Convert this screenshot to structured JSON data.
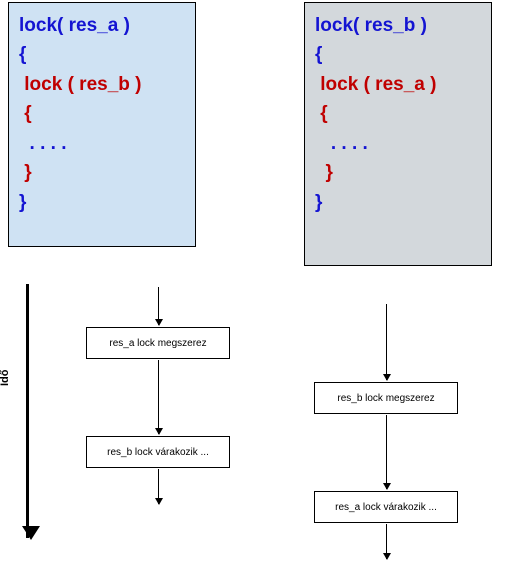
{
  "colors": {
    "block_left_bg": "#cfe2f3",
    "block_right_bg": "#d3d8dc",
    "outer_code": "#1414d2",
    "inner_code": "#c00000"
  },
  "left_code": {
    "l1": "lock( res_a )",
    "l2": "{",
    "l3": " lock ( res_b )",
    "l4": " {",
    "l5": "  . . . .",
    "l6": " }",
    "l7": "}"
  },
  "right_code": {
    "l1": "lock( res_b )",
    "l2": "{",
    "l3": " lock ( res_a )",
    "l4": " {",
    "l5": "   . . . .",
    "l6": "  }",
    "l7": "}"
  },
  "flow": {
    "a1": "res_a lock megszerez",
    "a2": "res_b lock várakozik ...",
    "b1": "res_b lock megszerez",
    "b2": "res_a lock várakozik ..."
  },
  "axis": {
    "label": "Idő"
  }
}
